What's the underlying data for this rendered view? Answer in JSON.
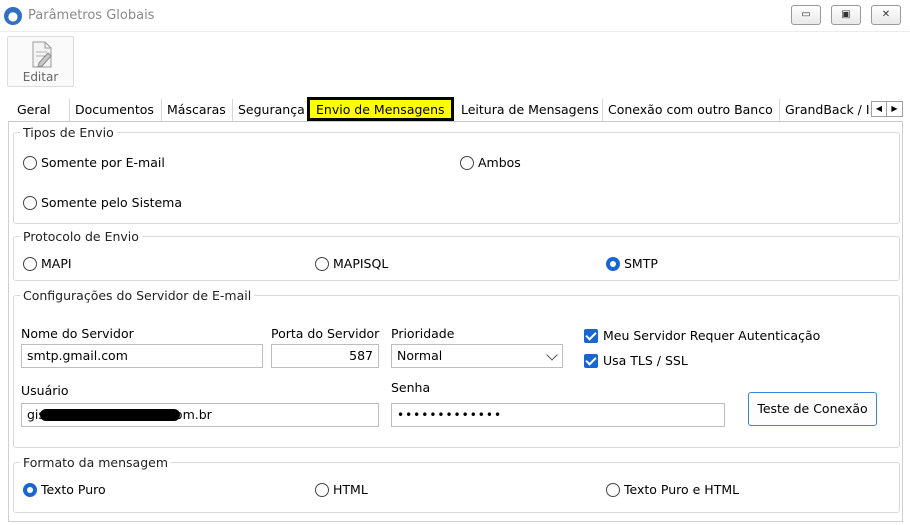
{
  "window": {
    "title": "Parâmetros Globais",
    "controls": {
      "minimize": "▭",
      "restore": "▣",
      "close": "✕"
    }
  },
  "toolbar": {
    "edit_label": "Editar"
  },
  "tabs": [
    "Geral",
    "Documentos",
    "Máscaras",
    "Segurança",
    "Envio de Mensagens",
    "Leitura de Mensagens",
    "Conexão com outro Banco",
    "GrandBack / I"
  ],
  "active_tab": "Envio de Mensagens",
  "tab_scroll": {
    "left": "◀",
    "right": "▶"
  },
  "tipos_envio": {
    "legend": "Tipos de Envio",
    "options": [
      "Somente por E-mail",
      "Ambos",
      "Somente pelo Sistema"
    ],
    "selected": null
  },
  "protocolo": {
    "legend": "Protocolo de Envio",
    "options": [
      "MAPI",
      "MAPISQL",
      "SMTP"
    ],
    "selected": "SMTP"
  },
  "servidor": {
    "legend": "Configurações do Servidor de E-mail",
    "nome_label": "Nome do Servidor",
    "nome_value": "smtp.gmail.com",
    "porta_label": "Porta do Servidor",
    "porta_value": "587",
    "prioridade_label": "Prioridade",
    "prioridade_value": "Normal",
    "auth_label": "Meu Servidor Requer Autenticação",
    "auth_checked": true,
    "tls_label": "Usa TLS / SSL",
    "tls_checked": true,
    "usuario_label": "Usuário",
    "usuario_value_prefix": "gis",
    "usuario_value_suffix": "om.br",
    "senha_label": "Senha",
    "senha_value": "•••••••••••••",
    "test_button": "Teste de Conexão"
  },
  "formato": {
    "legend": "Formato da mensagem",
    "options": [
      "Texto Puro",
      "HTML",
      "Texto Puro e HTML"
    ],
    "selected": "Texto Puro"
  },
  "colors": {
    "accent": "#1a66d0",
    "active_tab_bg": "#ffff00",
    "active_tab_border": "#000000",
    "button_border": "#3e82d6"
  }
}
